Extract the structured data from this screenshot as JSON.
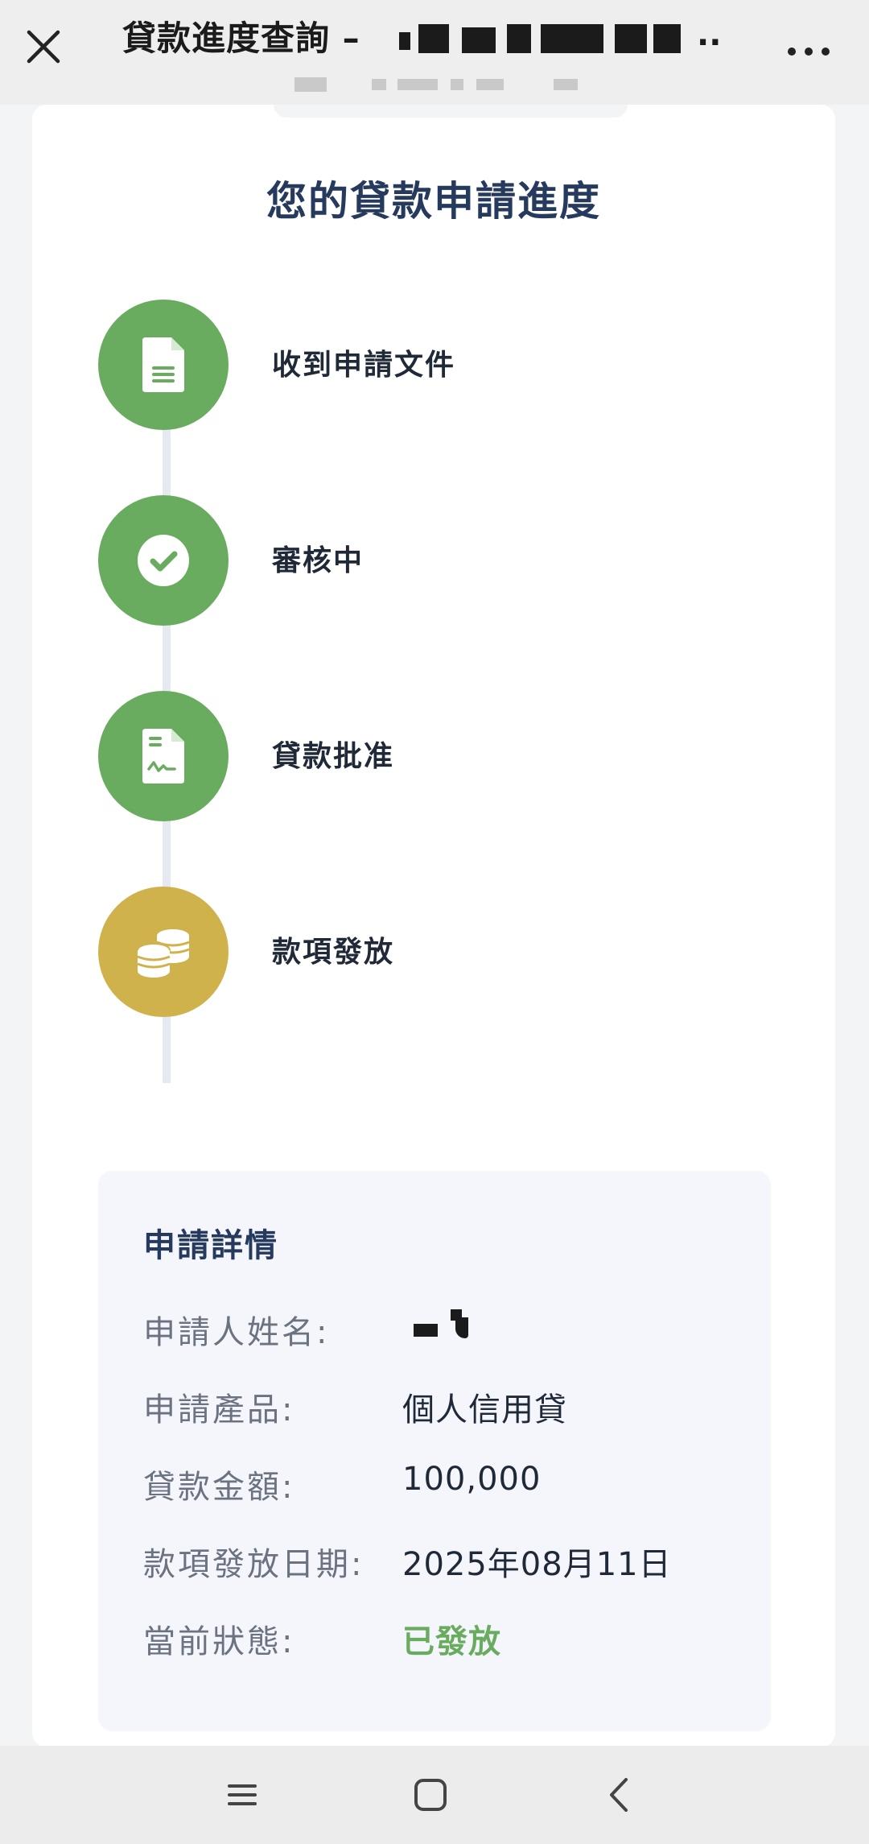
{
  "header": {
    "title": "貸款進度查詢 –",
    "ellipsis": "..",
    "close_icon": "close-icon",
    "more_icon": "more-horizontal-icon"
  },
  "progress": {
    "title": "您的貸款申請進度",
    "steps": [
      {
        "label": "收到申請文件",
        "icon": "document-icon",
        "color": "#6aac5f"
      },
      {
        "label": "審核中",
        "icon": "check-circle-icon",
        "color": "#6aac5f"
      },
      {
        "label": "貸款批准",
        "icon": "signed-document-icon",
        "color": "#6aac5f"
      },
      {
        "label": "款項發放",
        "icon": "coins-icon",
        "color": "#d0b24c"
      }
    ]
  },
  "details": {
    "title": "申請詳情",
    "rows": [
      {
        "label": "申請人姓名:",
        "value": ""
      },
      {
        "label": "申請產品:",
        "value": "個人信用貸"
      },
      {
        "label": "貸款金額:",
        "value": "100,000"
      },
      {
        "label": "款項發放日期:",
        "value": "2025年08月11日"
      },
      {
        "label": "當前狀態:",
        "value": "已發放",
        "color": "#6aac5f"
      }
    ]
  },
  "bottom_nav": {
    "items": [
      "menu-icon",
      "home-square-icon",
      "back-chevron-icon"
    ]
  }
}
